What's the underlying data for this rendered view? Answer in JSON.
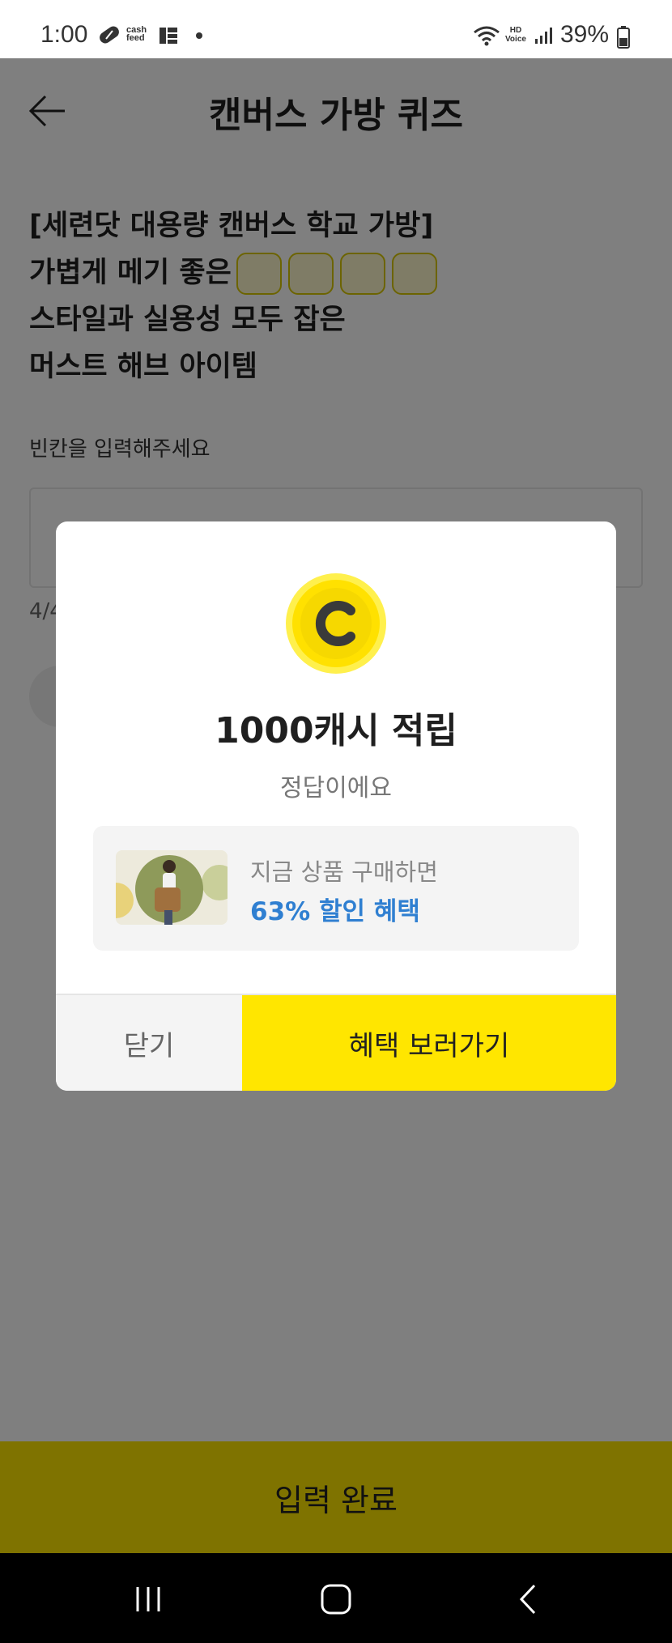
{
  "status_bar": {
    "time": "1:00",
    "cashfeed_line1": "cash",
    "cashfeed_line2": "feed",
    "hd_line1": "HD",
    "hd_line2": "Voice",
    "battery": "39%"
  },
  "header": {
    "title": "캔버스 가방 퀴즈",
    "back_icon": "arrow-left-icon"
  },
  "quiz": {
    "line1": "[세련닷 대용량 캔버스 학교 가방]",
    "line2_prefix": "가볍게 메기 좋은",
    "blank_count": 4,
    "line3": "스타일과 실용성 모두 잡은",
    "line4": "머스트 해브 아이템",
    "input_label": "빈칸을 입력해주세요",
    "answer_value": "",
    "char_count": "4/4"
  },
  "submit": {
    "label": "입력 완료"
  },
  "modal": {
    "coin_letter": "C",
    "title": "1000캐시 적립",
    "subtitle": "정답이에요",
    "promo_line1": "지금 상품 구매하면",
    "promo_line2": "63% 할인 혜택",
    "close_label": "닫기",
    "benefit_label": "혜택 보러가기"
  },
  "colors": {
    "accent_yellow": "#ffe600",
    "promo_blue": "#2f7fd1",
    "overlay": "rgba(0,0,0,0.5)"
  }
}
